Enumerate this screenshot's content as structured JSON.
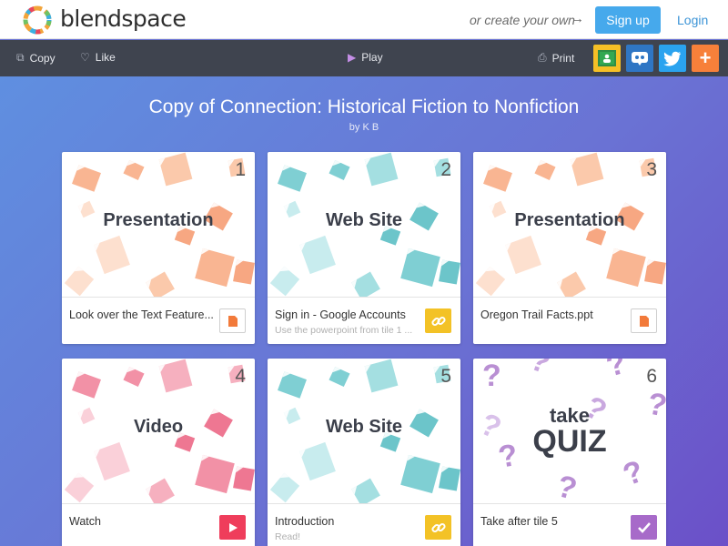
{
  "header": {
    "logo_text": "blendspace",
    "create_text": "or create your own",
    "signup_label": "Sign up",
    "login_label": "Login"
  },
  "toolbar": {
    "copy_label": "Copy",
    "like_label": "Like",
    "play_label": "Play",
    "print_label": "Print",
    "share_icons": [
      "google-classroom-icon",
      "edmodo-icon",
      "twitter-icon",
      "add-icon"
    ]
  },
  "lesson": {
    "title": "Copy of Connection: Historical Fiction to Nonfiction",
    "author": "by K B"
  },
  "tiles": [
    {
      "number": "1",
      "type": "Presentation",
      "name": "Look over the Text Feature...",
      "subtitle": "",
      "icon": "document-icon"
    },
    {
      "number": "2",
      "type": "Web Site",
      "name": "Sign in - Google Accounts",
      "subtitle": "Use the powerpoint from tile 1 ...",
      "icon": "link-icon"
    },
    {
      "number": "3",
      "type": "Presentation",
      "name": "Oregon Trail Facts.ppt",
      "subtitle": "",
      "icon": "document-icon"
    },
    {
      "number": "4",
      "type": "Video",
      "name": "Watch",
      "subtitle": "",
      "icon": "play-icon"
    },
    {
      "number": "5",
      "type": "Web Site",
      "name": "Introduction",
      "subtitle": "Read!",
      "icon": "link-icon"
    },
    {
      "number": "6",
      "type": "take QUIZ",
      "label_small": "take",
      "label_big": "QUIZ",
      "name": "Take after tile 5",
      "subtitle": "",
      "icon": "check-icon"
    }
  ],
  "colors": {
    "background": "#6a73d4",
    "toolbar": "#3f444f",
    "signup": "#46a9ec",
    "presentation": "#f9b592",
    "website": "#8fd6d8",
    "video": "#f291a6",
    "quiz": "#c9a8df"
  }
}
